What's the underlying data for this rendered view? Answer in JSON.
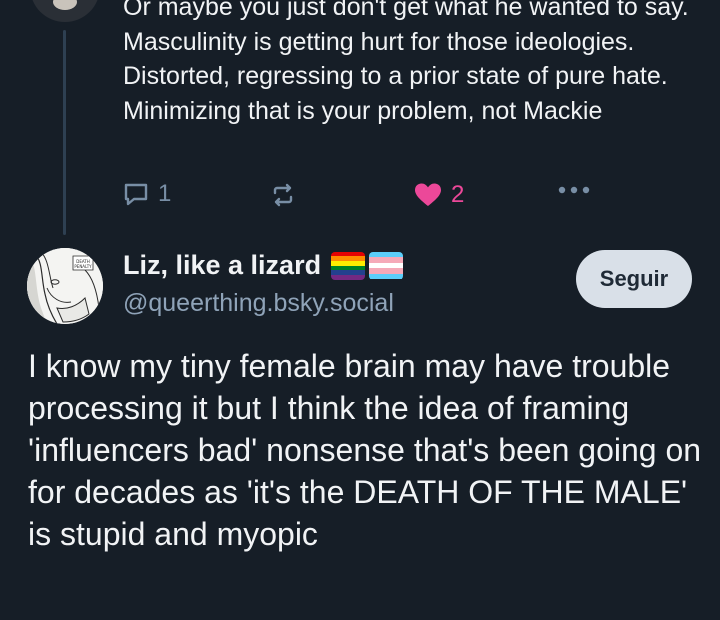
{
  "previous_post": {
    "text": "Or maybe you just don't get what he wanted to say. Masculinity is getting hurt for those ideologies. Distorted, regressing to a prior state of pure hate. Minimizing that is your problem, not Mackie",
    "reply_count": "1",
    "like_count": "2",
    "like_color": "#ec4899"
  },
  "post": {
    "display_name": "Liz, like a lizard",
    "handle": "@queerthing.bsky.social",
    "follow_label": "Seguir",
    "text": "I know my tiny female brain may have trouble processing it but I think the idea of framing 'influencers bad' nonsense that's been going on for decades as 'it's the DEATH OF THE MALE' is stupid and myopic",
    "avatar_caption": "DEATH PENALTY",
    "flags": [
      "rainbow-pride-flag",
      "transgender-flag"
    ]
  },
  "icons": {
    "reply": "reply-icon",
    "repost": "repost-icon",
    "like": "heart-icon",
    "more": "more-dots-icon"
  },
  "colors": {
    "background": "#161e27",
    "text": "#f1f3f5",
    "muted": "#788ea5",
    "handle": "#8fa3b8",
    "follow_bg": "#d9e0e8"
  }
}
